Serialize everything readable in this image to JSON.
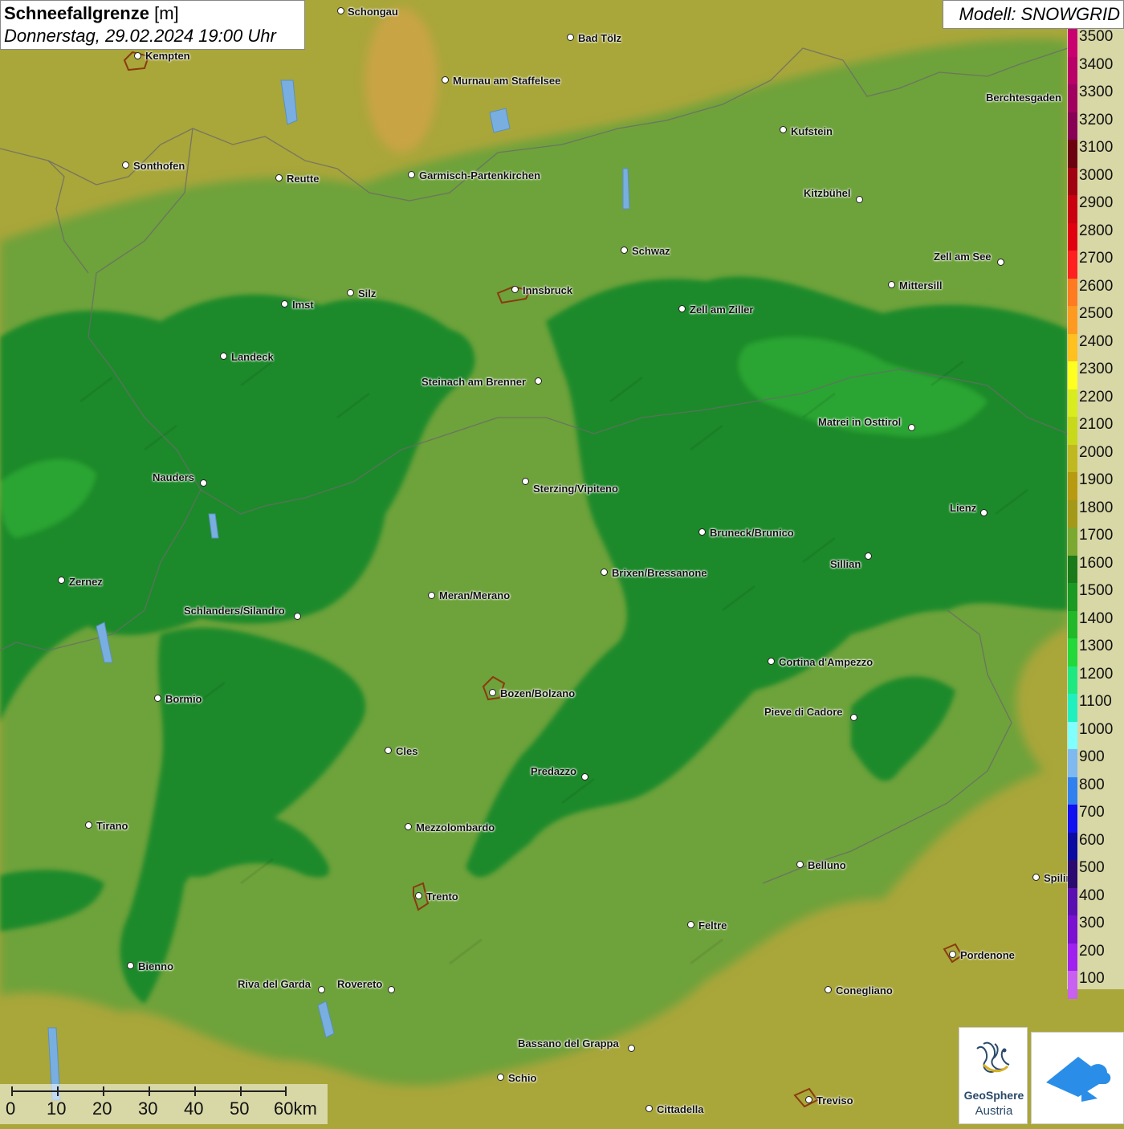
{
  "title": {
    "main": "Schneefallgrenze",
    "unit": "[m]",
    "datetime": "Donnerstag, 29.02.2024 19:00 Uhr"
  },
  "model": "Modell: SNOWGRID",
  "legend": {
    "entries": [
      {
        "label": "3500",
        "color": "#c80070"
      },
      {
        "label": "3400",
        "color": "#b80068"
      },
      {
        "label": "3300",
        "color": "#a00060"
      },
      {
        "label": "3200",
        "color": "#880055"
      },
      {
        "label": "3100",
        "color": "#6a0010"
      },
      {
        "label": "3000",
        "color": "#a00010"
      },
      {
        "label": "2900",
        "color": "#c80010"
      },
      {
        "label": "2800",
        "color": "#e00010"
      },
      {
        "label": "2700",
        "color": "#ff2020"
      },
      {
        "label": "2600",
        "color": "#ff7a20"
      },
      {
        "label": "2500",
        "color": "#ff9a20"
      },
      {
        "label": "2400",
        "color": "#ffc020"
      },
      {
        "label": "2300",
        "color": "#ffff20"
      },
      {
        "label": "2200",
        "color": "#d8ec20"
      },
      {
        "label": "2100",
        "color": "#c8d81a"
      },
      {
        "label": "2000",
        "color": "#c0b820"
      },
      {
        "label": "1900",
        "color": "#b89a10"
      },
      {
        "label": "1800",
        "color": "#a49818"
      },
      {
        "label": "1700",
        "color": "#7aa830"
      },
      {
        "label": "1600",
        "color": "#1a7a1a"
      },
      {
        "label": "1500",
        "color": "#1a9a22"
      },
      {
        "label": "1400",
        "color": "#22b82a"
      },
      {
        "label": "1300",
        "color": "#22d83a"
      },
      {
        "label": "1200",
        "color": "#20e880"
      },
      {
        "label": "1100",
        "color": "#20f0c0"
      },
      {
        "label": "1000",
        "color": "#80ffff"
      },
      {
        "label": "900",
        "color": "#80b8f0"
      },
      {
        "label": "800",
        "color": "#3080f0"
      },
      {
        "label": "700",
        "color": "#1010f0"
      },
      {
        "label": "600",
        "color": "#0a0aa0"
      },
      {
        "label": "500",
        "color": "#2a0a70"
      },
      {
        "label": "400",
        "color": "#5a10b0"
      },
      {
        "label": "300",
        "color": "#7a10d0"
      },
      {
        "label": "200",
        "color": "#a020f0"
      },
      {
        "label": "100",
        "color": "#c860f0"
      }
    ]
  },
  "cities": [
    {
      "name": "Schongau"
    },
    {
      "name": "Bad Tölz"
    },
    {
      "name": "Kempten"
    },
    {
      "name": "Murnau am Staffelsee"
    },
    {
      "name": "Kufstein"
    },
    {
      "name": "Berchtesgaden"
    },
    {
      "name": "Sonthofen"
    },
    {
      "name": "Reutte"
    },
    {
      "name": "Garmisch-Partenkirchen"
    },
    {
      "name": "Kitzbühel"
    },
    {
      "name": "Schwaz"
    },
    {
      "name": "Zell am See"
    },
    {
      "name": "Innsbruck"
    },
    {
      "name": "Imst"
    },
    {
      "name": "Silz"
    },
    {
      "name": "Mittersill"
    },
    {
      "name": "Zell am Ziller"
    },
    {
      "name": "Landeck"
    },
    {
      "name": "Steinach am Brenner"
    },
    {
      "name": "Matrei in Osttirol"
    },
    {
      "name": "Nauders"
    },
    {
      "name": "Sterzing/Vipiteno"
    },
    {
      "name": "Lienz"
    },
    {
      "name": "Bruneck/Brunico"
    },
    {
      "name": "Sillian"
    },
    {
      "name": "Brixen/Bressanone"
    },
    {
      "name": "Zernez"
    },
    {
      "name": "Meran/Merano"
    },
    {
      "name": "Schlanders/Silandro"
    },
    {
      "name": "Cortina d'Ampezzo"
    },
    {
      "name": "Bozen/Bolzano"
    },
    {
      "name": "Bormio"
    },
    {
      "name": "Pieve di Cadore"
    },
    {
      "name": "Cles"
    },
    {
      "name": "Predazzo"
    },
    {
      "name": "Tirano"
    },
    {
      "name": "Mezzolombardo"
    },
    {
      "name": "Belluno"
    },
    {
      "name": "Spilimbergo"
    },
    {
      "name": "Trento"
    },
    {
      "name": "Feltre"
    },
    {
      "name": "Pordenone"
    },
    {
      "name": "Bienno"
    },
    {
      "name": "Riva del Garda"
    },
    {
      "name": "Rovereto"
    },
    {
      "name": "Conegliano"
    },
    {
      "name": "Bassano del Grappa"
    },
    {
      "name": "Schio"
    },
    {
      "name": "Treviso"
    },
    {
      "name": "Cittadella"
    }
  ],
  "scale": {
    "labels": [
      "0",
      "10",
      "20",
      "30",
      "40",
      "50",
      "60km"
    ]
  },
  "logos": {
    "geosphere_name": "GeoSphere",
    "geosphere_sub": "Austria"
  },
  "colors": {
    "low_green": "#1f8a2a",
    "mid_green": "#6aa33a",
    "olive": "#a9a63a",
    "orange_high": "#c8a640"
  }
}
